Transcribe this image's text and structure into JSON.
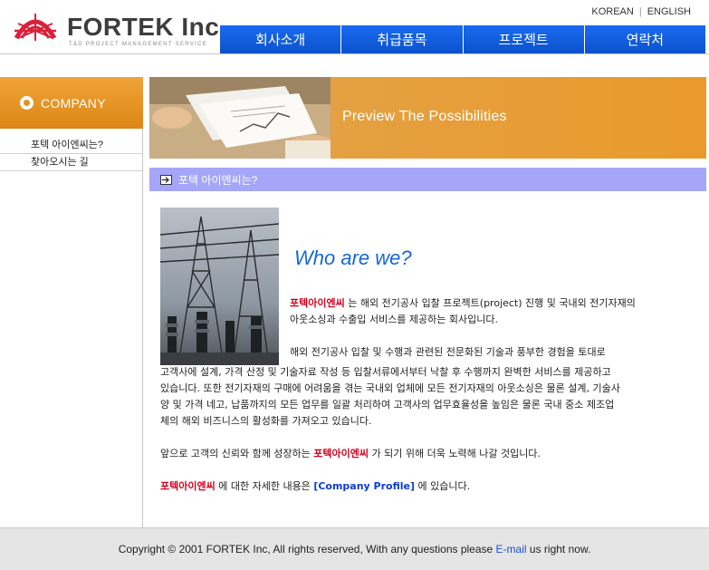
{
  "header": {
    "logo_text": "FORTEK Inc.",
    "logo_subtitle": "T&D PROJECT MANAGEMENT SERVICE",
    "lang": {
      "korean": "KOREAN",
      "separator": "|",
      "english": "ENGLISH"
    },
    "nav": [
      {
        "label": "회사소개"
      },
      {
        "label": "취급품목"
      },
      {
        "label": "프로젝트"
      },
      {
        "label": "연락처"
      }
    ]
  },
  "sidebar": {
    "title": "COMPANY",
    "items": [
      {
        "label": "포텍 아이엔씨는?"
      },
      {
        "label": "찾아오시는 길"
      }
    ]
  },
  "banner": {
    "text": "Preview The Possibilities"
  },
  "section": {
    "title": "포텍 아이엔씨는?"
  },
  "content": {
    "headline": "Who are we?",
    "brand": "포텍아이엔씨",
    "p1_line1_rest": "는 해외 전기공사 입찰 프로젝트(project) 진행 및 국내외 전기자재의",
    "p1_line2": "아웃소싱과 수출입 서비스를 제공하는 회사입니다.",
    "p2_line1": "해외 전기공사 입찰 및 수행과 관련된 전문화된 기술과 풍부한 경험을 토대로",
    "p2_line2": "고객사에 설계, 가격 산정 및 기술자료 작성 등 입찰서류에서부터 낙찰 후 수행까지 완벽한 서비스를 제공하고",
    "p2_line3": "있습니다. 또한 전기자재의 구매에 어려움을 겪는 국내외 업체에 모든 전기자재의 아웃소싱은 물론 설계, 기술사",
    "p2_line4": "양 및 가격 네고, 납품까지의 모든 업무를 일괄 처리하여 고객사의 업무효율성을 높임은 물론 국내 중소 제조업",
    "p2_line5": "체의 해외 비즈니스의 활성화를 가져오고 있습니다.",
    "p3_before": "앞으로 고객의 신뢰와 함께 성장하는",
    "p3_after": "가 되기 위해 더욱 노력해 나갈 것입니다.",
    "p4_middle": "에 대한 자세한 내용은",
    "p4_link": "[Company Profile]",
    "p4_after": "에 있습니다."
  },
  "footer": {
    "text_before": "Copyright © 2001  FORTEK Inc, All rights reserved, With any questions please",
    "link": "E-mail",
    "text_after": "us right now."
  },
  "colors": {
    "nav_blue": "#0b52cc",
    "sidebar_orange": "#e7911f",
    "section_bar": "#a6a6f8",
    "headline_blue": "#1566d6",
    "brand_red": "#d4001c",
    "link_blue": "#0d3bd8"
  }
}
